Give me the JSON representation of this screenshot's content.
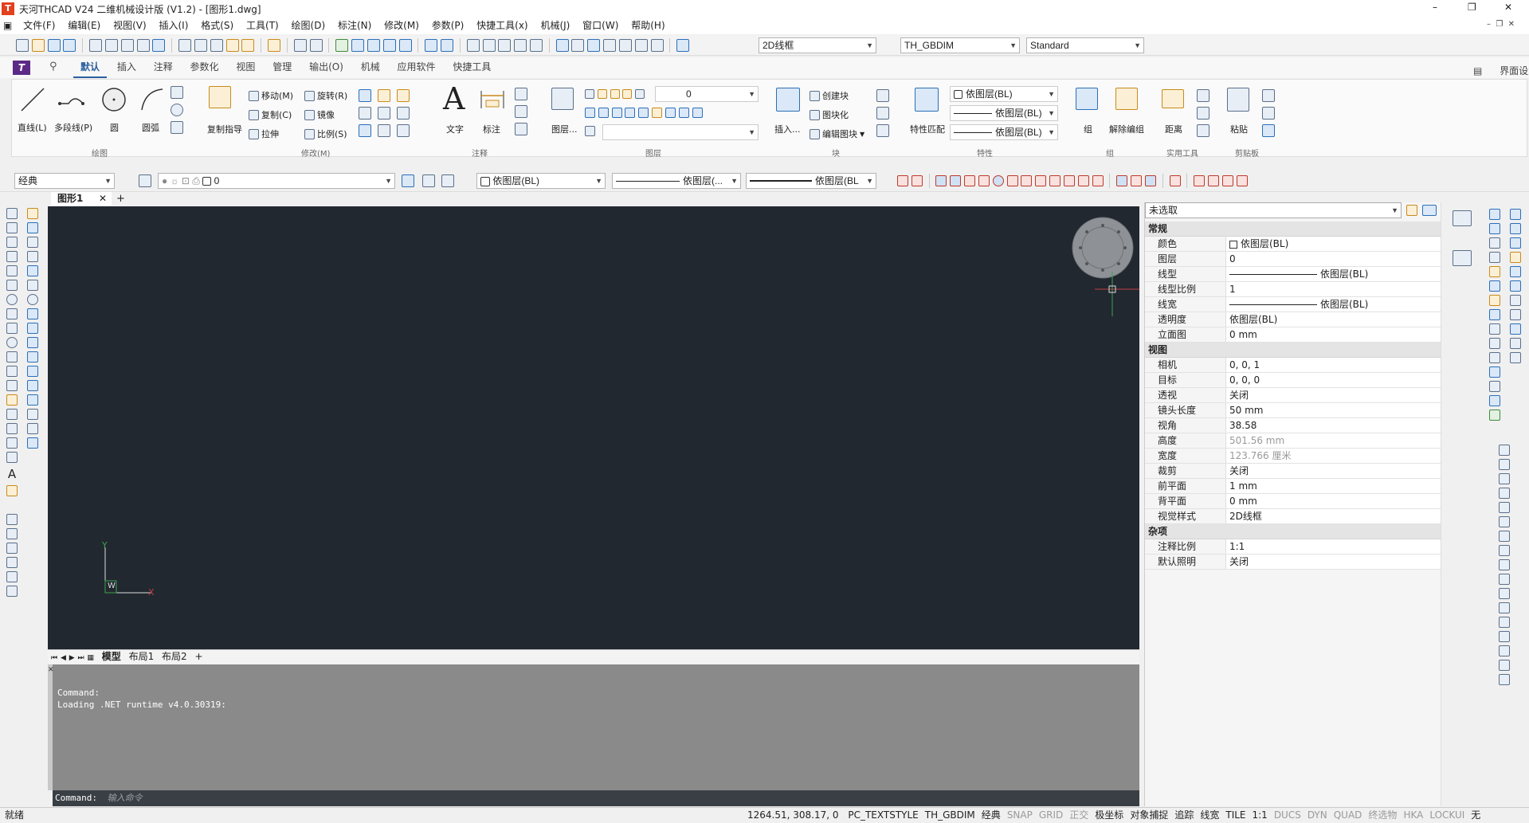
{
  "titlebar": {
    "title": "天河THCAD V24 二维机械设计版 (V1.2) - [图形1.dwg]",
    "min": "–",
    "max": "❐",
    "close": "✕"
  },
  "menubar": {
    "items": [
      "文件(F)",
      "编辑(E)",
      "视图(V)",
      "插入(I)",
      "格式(S)",
      "工具(T)",
      "绘图(D)",
      "标注(N)",
      "修改(M)",
      "参数(P)",
      "快捷工具(x)",
      "机械(J)",
      "窗口(W)",
      "帮助(H)"
    ]
  },
  "quickbar": {
    "visual_style": "2D线框",
    "dim_style": "TH_GBDIM",
    "text_style": "Standard"
  },
  "ribbon": {
    "tabs": [
      "默认",
      "插入",
      "注释",
      "参数化",
      "视图",
      "管理",
      "输出(O)",
      "机械",
      "应用软件",
      "快捷工具"
    ],
    "active_tab": "默认",
    "ui_settings": "界面设置",
    "draw": {
      "line": "直线(L)",
      "polyline": "多段线(P)",
      "circle": "圆",
      "arc": "圆弧",
      "group": "绘图"
    },
    "modify": {
      "move": "移动(M)",
      "rotate": "旋转(R)",
      "copy": "复制(C)",
      "mirror": "镜像",
      "copy_guide": "复制指导",
      "stretch": "拉伸",
      "scale": "比例(S)",
      "group": "修改(M)"
    },
    "annot": {
      "text": "文字",
      "dim": "标注",
      "group": "注释"
    },
    "layer": {
      "layers": "图层...",
      "current": "0",
      "group": "图层"
    },
    "block": {
      "insert": "插入...",
      "create": "创建块",
      "blockify": "图块化",
      "edit": "编辑图块",
      "group": "块"
    },
    "props": {
      "match": "特性匹配",
      "color": "依图层(BL)",
      "linetype": "依图层(BL)",
      "lineweight": "依图层(BL)",
      "group": "特性"
    },
    "groupp": {
      "group_btn": "组",
      "ungroup": "解除编组",
      "group": "组"
    },
    "util": {
      "distance": "距离",
      "group": "实用工具"
    },
    "clip": {
      "paste": "粘贴",
      "group": "剪贴板"
    }
  },
  "toolbar2": {
    "workspace": "经典",
    "layer": "0",
    "color": "依图层(BL)",
    "linetype": "依图层(...",
    "lineweight": "依图层(BL"
  },
  "doc_tabs": {
    "name": "图形1",
    "close": "✕",
    "add": "+"
  },
  "ucs": {
    "y": "Y",
    "x": "X",
    "w": "W"
  },
  "layout_tabs": {
    "model": "模型",
    "layout1": "布局1",
    "layout2": "布局2",
    "add": "+"
  },
  "command": {
    "lines": [
      "Command:",
      "Loading .NET runtime v4.0.30319:"
    ],
    "prompt": "Command:",
    "placeholder": "输入命令"
  },
  "properties": {
    "selector": "未选取",
    "cats": [
      {
        "name": "常规",
        "rows": [
          [
            "颜色",
            "依图层(BL)"
          ],
          [
            "图层",
            "0"
          ],
          [
            "线型",
            "依图层(BL)"
          ],
          [
            "线型比例",
            "1"
          ],
          [
            "线宽",
            "依图层(BL)"
          ],
          [
            "透明度",
            "依图层(BL)"
          ],
          [
            "立面图",
            "0 mm"
          ]
        ]
      },
      {
        "name": "视图",
        "rows": [
          [
            "相机",
            "0, 0, 1"
          ],
          [
            "目标",
            "0, 0, 0"
          ],
          [
            "透视",
            "关闭"
          ],
          [
            "镜头长度",
            "50 mm"
          ],
          [
            "视角",
            "38.58"
          ],
          [
            "高度",
            "501.56 mm"
          ],
          [
            "宽度",
            "123.766 厘米"
          ],
          [
            "裁剪",
            "关闭"
          ],
          [
            "前平面",
            "1 mm"
          ],
          [
            "背平面",
            "0 mm"
          ],
          [
            "视觉样式",
            "2D线框"
          ]
        ]
      },
      {
        "name": "杂项",
        "rows": [
          [
            "注释比例",
            "1:1"
          ],
          [
            "默认照明",
            "关闭"
          ]
        ]
      }
    ]
  },
  "statusbar": {
    "left": "就绪",
    "coords": "1264.51, 308.17, 0",
    "items": [
      [
        "PC_TEXTSTYLE",
        true
      ],
      [
        "TH_GBDIM",
        true
      ],
      [
        "经典",
        true
      ],
      [
        "SNAP",
        false
      ],
      [
        "GRID",
        false
      ],
      [
        "正交",
        false
      ],
      [
        "极坐标",
        true
      ],
      [
        "对象捕捉",
        true
      ],
      [
        "追踪",
        true
      ],
      [
        "线宽",
        true
      ],
      [
        "TILE",
        true
      ],
      [
        "1:1",
        true
      ],
      [
        "DUCS",
        false
      ],
      [
        "DYN",
        false
      ],
      [
        "QUAD",
        false
      ],
      [
        "终选物",
        false
      ],
      [
        "HKA",
        false
      ],
      [
        "LOCKUI",
        false
      ],
      [
        "无",
        true
      ]
    ]
  },
  "colors": {
    "canvas": "#212830",
    "cmd_bg": "#8a8a8a",
    "accent": "#2b5fa0",
    "brand": "#e2401f"
  }
}
